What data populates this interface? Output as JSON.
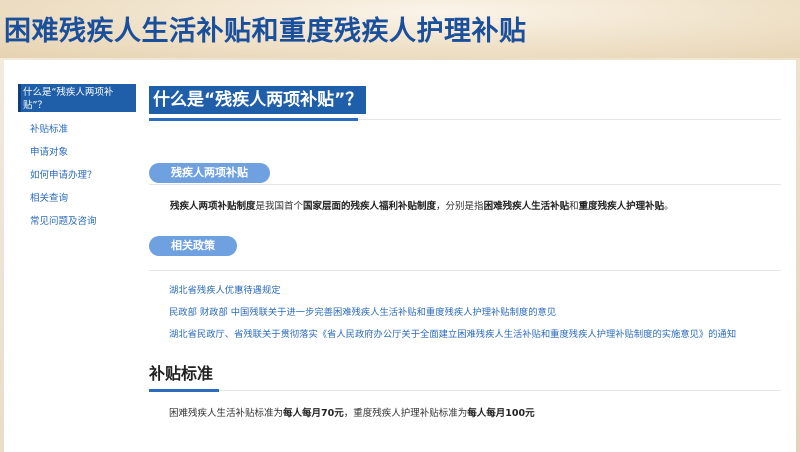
{
  "banner": {
    "title": "困难残疾人生活补贴和重度残疾人护理补贴"
  },
  "sidebar": {
    "active": "什么是“残疾人两项补贴”？",
    "items": [
      {
        "label": "补贴标准"
      },
      {
        "label": "申请对象"
      },
      {
        "label": "如何申请办理？"
      },
      {
        "label": "相关查询"
      },
      {
        "label": "常见问题及咨询"
      }
    ]
  },
  "main": {
    "title": "什么是“残疾人两项补贴”？",
    "section1": {
      "pill": "残疾人两项补贴",
      "p_b1": "残疾人两项补贴制度",
      "p_t1": "是我国首个",
      "p_b2": "国家层面的残疾人福利补贴制度",
      "p_t2": "，分别是指",
      "p_b3": "困难残疾人生活补贴",
      "p_t3": "和",
      "p_b4": "重度残疾人护理补贴",
      "p_t4": "。"
    },
    "section2": {
      "pill": "相关政策",
      "links": [
        "湖北省残疾人优惠待遇规定",
        "民政部 财政部 中国残联关于进一步完善困难残疾人生活补贴和重度残疾人护理补贴制度的意见",
        "湖北省民政厅、省残联关于贯彻落实《省人民政府办公厅关于全面建立困难残疾人生活补贴和重度残疾人护理补贴制度的实施意见》的通知"
      ]
    },
    "section3": {
      "title": "补贴标准",
      "p_t1": "困难残疾人生活补贴标准为",
      "p_b1": "每人每月70元",
      "p_t2": "，重度残疾人护理补贴标准为",
      "p_b2": "每人每月100元"
    }
  },
  "colors": {
    "brand_blue": "#1f5ea8",
    "link_blue": "#2b6bbd",
    "pill_blue": "#6fa0e0"
  }
}
